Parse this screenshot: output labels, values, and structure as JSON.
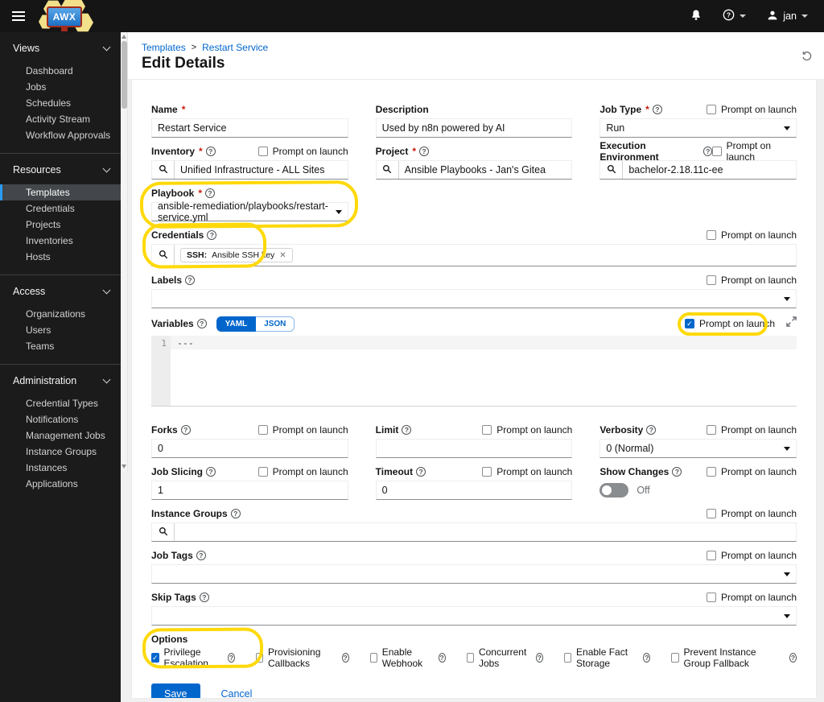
{
  "navbar": {
    "user": "jan"
  },
  "colors": {
    "accent": "#0066cc",
    "masthead": "#151515",
    "sidebar": "#1b1b1b",
    "active_item_border": "#2b9af3",
    "highlight": "#ffd90a",
    "required": "#c9190b"
  },
  "sidebar": {
    "sections": [
      {
        "label": "Views",
        "items": [
          "Dashboard",
          "Jobs",
          "Schedules",
          "Activity Stream",
          "Workflow Approvals"
        ]
      },
      {
        "label": "Resources",
        "items": [
          "Templates",
          "Credentials",
          "Projects",
          "Inventories",
          "Hosts"
        ]
      },
      {
        "label": "Access",
        "items": [
          "Organizations",
          "Users",
          "Teams"
        ]
      },
      {
        "label": "Administration",
        "items": [
          "Credential Types",
          "Notifications",
          "Management Jobs",
          "Instance Groups",
          "Instances",
          "Applications"
        ]
      }
    ],
    "active_item": "Templates"
  },
  "breadcrumb": {
    "items": [
      "Templates",
      "Restart Service"
    ],
    "separator": ">"
  },
  "page": {
    "title": "Edit Details"
  },
  "form": {
    "prompt_label": "Prompt on launch",
    "name": {
      "label": "Name",
      "value": "Restart Service"
    },
    "description": {
      "label": "Description",
      "value": "Used by n8n powered by AI"
    },
    "job_type": {
      "label": "Job Type",
      "value": "Run"
    },
    "inventory": {
      "label": "Inventory",
      "value": "Unified Infrastructure - ALL Sites"
    },
    "project": {
      "label": "Project",
      "value": "Ansible Playbooks - Jan's Gitea"
    },
    "execution_environment": {
      "label": "Execution Environment",
      "value": "bachelor-2.18.11c-ee"
    },
    "playbook": {
      "label": "Playbook",
      "value": "ansible-remediation/playbooks/restart-service.yml"
    },
    "credentials": {
      "label": "Credentials",
      "chip_type": "SSH:",
      "chip_name": "Ansible SSH key"
    },
    "labels": {
      "label": "Labels",
      "value": ""
    },
    "variables": {
      "label": "Variables",
      "tab_yaml": "YAML",
      "tab_json": "JSON",
      "line_number": "1",
      "content": "---",
      "prompt_checked": true
    },
    "forks": {
      "label": "Forks",
      "value": "0"
    },
    "limit": {
      "label": "Limit",
      "value": ""
    },
    "verbosity": {
      "label": "Verbosity",
      "value": "0 (Normal)"
    },
    "job_slicing": {
      "label": "Job Slicing",
      "value": "1"
    },
    "timeout": {
      "label": "Timeout",
      "value": "0"
    },
    "show_changes": {
      "label": "Show Changes",
      "state": "Off"
    },
    "instance_groups": {
      "label": "Instance Groups",
      "value": ""
    },
    "job_tags": {
      "label": "Job Tags",
      "value": ""
    },
    "skip_tags": {
      "label": "Skip Tags",
      "value": ""
    },
    "options": {
      "title": "Options",
      "items": [
        {
          "label": "Privilege Escalation",
          "checked": true
        },
        {
          "label": "Provisioning Callbacks",
          "checked": false
        },
        {
          "label": "Enable Webhook",
          "checked": false
        },
        {
          "label": "Concurrent Jobs",
          "checked": false
        },
        {
          "label": "Enable Fact Storage",
          "checked": false
        },
        {
          "label": "Prevent Instance Group Fallback",
          "checked": false
        }
      ]
    },
    "actions": {
      "save": "Save",
      "cancel": "Cancel"
    }
  }
}
